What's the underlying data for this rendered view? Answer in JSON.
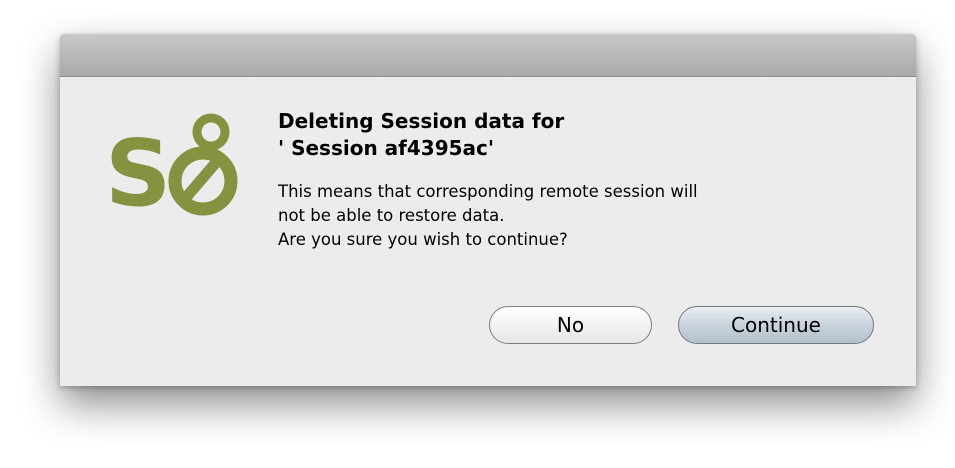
{
  "dialog": {
    "title_line1": "Deleting Session data for",
    "title_line2": "' Session af4395ac'",
    "message_line1": "This means that corresponding remote session will",
    "message_line2": "not be able to restore data.",
    "message_line3": "Are you sure you wish to continue?",
    "logo_icon": "selenium-logo-icon",
    "logo_color": "#86923f"
  },
  "buttons": {
    "no_label": "No",
    "continue_label": "Continue"
  }
}
